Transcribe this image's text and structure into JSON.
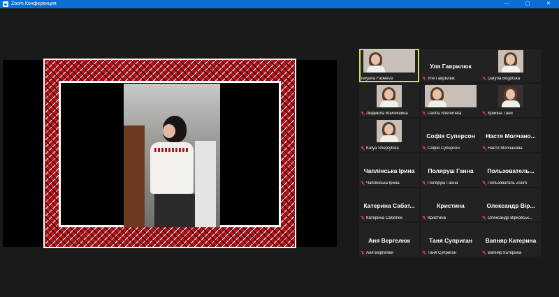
{
  "window": {
    "title": "Zoom Конференция",
    "minimize": "—",
    "maximize": "▢",
    "close": "✕"
  },
  "shared_video": {
    "description_icon": "video-feed"
  },
  "participants": [
    {
      "name": "",
      "label": "Tetyana Fadeeva",
      "video": true,
      "active": true,
      "muted": false
    },
    {
      "name": "Уля Гаврилюк",
      "label": "Уля Гаврилюк",
      "video": false,
      "muted": true
    },
    {
      "name": "",
      "label": "Daryna Bogotska",
      "video": true,
      "muted": true
    },
    {
      "name": "",
      "label": "Людмила Войчишина",
      "video": true,
      "muted": true
    },
    {
      "name": "",
      "label": "Dasha Sheremeta",
      "video": true,
      "muted": true
    },
    {
      "name": "",
      "label": "Крикіна Таня",
      "video": true,
      "muted": true,
      "dark": true
    },
    {
      "name": "",
      "label": "Katya Sheptytska",
      "video": true,
      "muted": true
    },
    {
      "name": "Софія Суперсон",
      "label": "Софія Суперсон",
      "video": false,
      "muted": true
    },
    {
      "name": "Настя Молчано...",
      "label": "Настя Молчанова",
      "video": false,
      "muted": true
    },
    {
      "name": "Чаплінська Ірина",
      "label": "Чаплінська Ірина",
      "video": false,
      "muted": true
    },
    {
      "name": "Поляруш Ганна",
      "label": "Поляруш Ганна",
      "video": false,
      "muted": true
    },
    {
      "name": "Пользователь...",
      "label": "Пользователь Zoom",
      "video": false,
      "muted": true
    },
    {
      "name": "Катерина Сабат...",
      "label": "Катерина Сабатюк",
      "video": false,
      "muted": true
    },
    {
      "name": "Кристина",
      "label": "Кристина",
      "video": false,
      "muted": true
    },
    {
      "name": "Олександр Вір...",
      "label": "Олександр Вірковськ...",
      "video": false,
      "muted": true
    },
    {
      "name": "Аня Вергелюк",
      "label": "Аня Вергелюк",
      "video": false,
      "muted": true
    },
    {
      "name": "Таня Суприган",
      "label": "Таня Суприган",
      "video": false,
      "muted": true
    },
    {
      "name": "Вапняр Катерина",
      "label": "Вапняр Катерина",
      "video": false,
      "muted": true
    }
  ]
}
